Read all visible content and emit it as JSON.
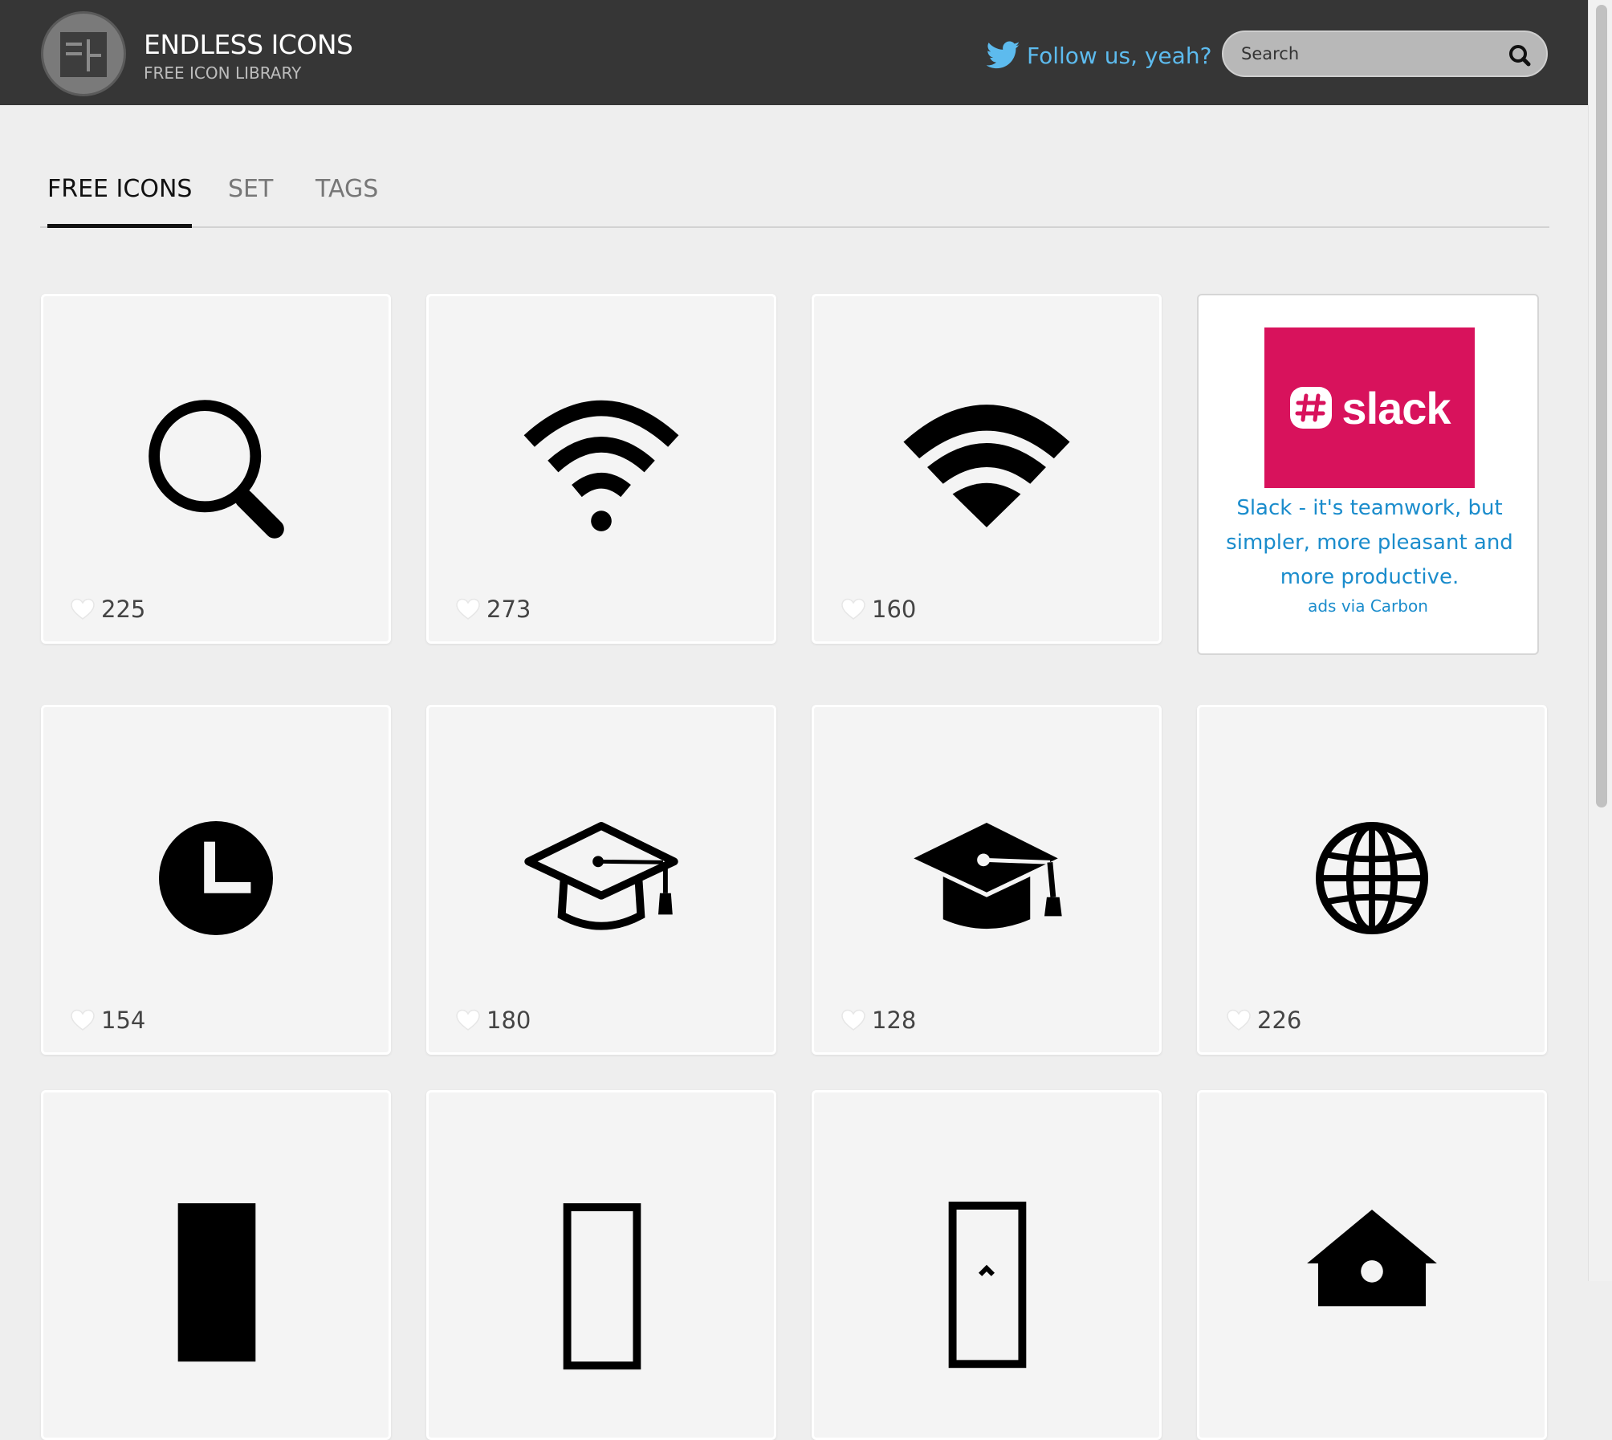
{
  "header": {
    "title": "ENDLESS ICONS",
    "subtitle": "FREE ICON LIBRARY",
    "follow_label": "Follow us, yeah?",
    "search_placeholder": "Search"
  },
  "tabs": [
    {
      "label": "FREE ICONS",
      "active": true
    },
    {
      "label": "SET",
      "active": false
    },
    {
      "label": "TAGS",
      "active": false
    }
  ],
  "cards": [
    {
      "icon": "search-icon",
      "likes": "225"
    },
    {
      "icon": "wifi-icon",
      "likes": "273"
    },
    {
      "icon": "wifi-wedge-icon",
      "likes": "160"
    },
    {
      "icon": "clock-icon",
      "likes": "154"
    },
    {
      "icon": "graduation-cap-outline-icon",
      "likes": "180"
    },
    {
      "icon": "graduation-cap-solid-icon",
      "likes": "128"
    },
    {
      "icon": "globe-icon",
      "likes": "226"
    },
    {
      "icon": "rectangle-solid-icon",
      "likes": ""
    },
    {
      "icon": "rectangle-outline-icon",
      "likes": ""
    },
    {
      "icon": "bookmark-outline-icon",
      "likes": ""
    },
    {
      "icon": "home-icon",
      "likes": ""
    }
  ],
  "ad": {
    "brand": "slack",
    "text": "Slack - it's teamwork, but simpler, more pleasant and more productive.",
    "via": "ads via Carbon"
  },
  "colors": {
    "header_bg": "#363636",
    "link": "#5dbbee",
    "ad_link": "#1a8ccc",
    "slack_bg": "#d8125c"
  }
}
